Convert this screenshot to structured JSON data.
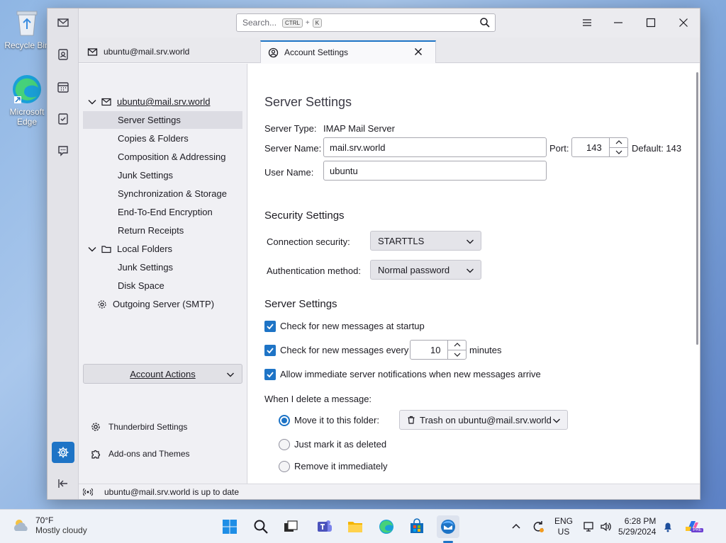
{
  "desktop": {
    "icons": [
      {
        "label": "Recycle Bin"
      },
      {
        "label": "Microsoft Edge"
      }
    ]
  },
  "search": {
    "placeholder": "Search...",
    "key1": "CTRL",
    "plus": "+",
    "key2": "K"
  },
  "tabs": [
    {
      "label": "ubuntu@mail.srv.world"
    },
    {
      "label": "Account Settings"
    }
  ],
  "tree": {
    "account": "ubuntu@mail.srv.world",
    "items": [
      "Server Settings",
      "Copies & Folders",
      "Composition & Addressing",
      "Junk Settings",
      "Synchronization & Storage",
      "End-To-End Encryption",
      "Return Receipts"
    ],
    "local_folders": "Local Folders",
    "local_items": [
      "Junk Settings",
      "Disk Space"
    ],
    "outgoing": "Outgoing Server (SMTP)"
  },
  "sidebar": {
    "account_actions": "Account Actions",
    "thunderbird_settings": "Thunderbird Settings",
    "addons": "Add-ons and Themes"
  },
  "server": {
    "title": "Server Settings",
    "type_label": "Server Type:",
    "type_value": "IMAP Mail Server",
    "name_label": "Server Name:",
    "name_value": "mail.srv.world",
    "port_label": "Port:",
    "port_value": "143",
    "default_label": "Default: 143",
    "user_label": "User Name:",
    "user_value": "ubuntu"
  },
  "security": {
    "title": "Security Settings",
    "conn_label": "Connection security:",
    "conn_value": "STARTTLS",
    "auth_label": "Authentication method:",
    "auth_value": "Normal password"
  },
  "server_settings": {
    "title": "Server Settings",
    "check_startup": "Check for new messages at startup",
    "check_every": "Check for new messages every",
    "check_every_value": "10",
    "minutes": "minutes",
    "allow_notifications": "Allow immediate server notifications when new messages arrive",
    "delete_label": "When I delete a message:",
    "move_label": "Move it to this folder:",
    "move_folder": "Trash on ubuntu@mail.srv.world",
    "mark_deleted": "Just mark it as deleted",
    "remove_immediately": "Remove it immediately"
  },
  "status": {
    "text": "ubuntu@mail.srv.world is up to date"
  },
  "taskbar": {
    "temp": "70°F",
    "condition": "Mostly cloudy",
    "lang1": "ENG",
    "lang2": "US",
    "time": "6:28 PM",
    "date": "5/29/2024",
    "pre": "PRE"
  },
  "colors": {
    "accent": "#1e74c6"
  }
}
